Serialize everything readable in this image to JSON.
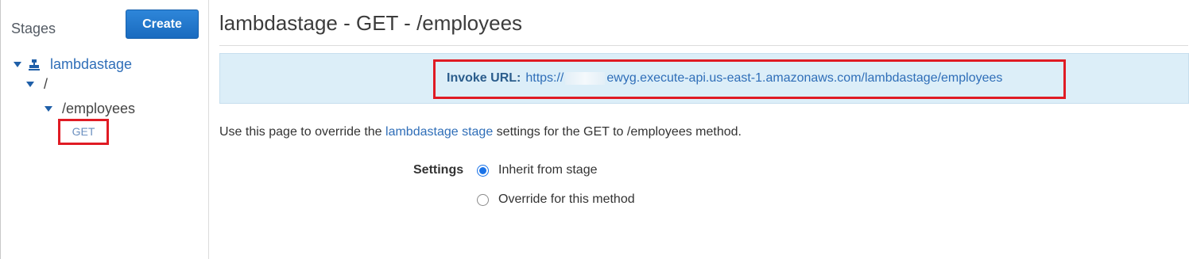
{
  "sidebar": {
    "heading": "Stages",
    "create_label": "Create",
    "tree": {
      "stage": "lambdastage",
      "root": "/",
      "resource": "/employees",
      "method": "GET"
    }
  },
  "main": {
    "title": "lambdastage - GET - /employees",
    "invoke": {
      "label": "Invoke URL:",
      "url_prefix": "https://",
      "url_suffix": "ewyg.execute-api.us-east-1.amazonaws.com/lambdastage/employees"
    },
    "description": {
      "prefix": "Use this page to override the ",
      "link": "lambdastage stage",
      "suffix": " settings for the GET to /employees method."
    },
    "settings": {
      "label": "Settings",
      "options": [
        {
          "label": "Inherit from stage",
          "selected": true
        },
        {
          "label": "Override for this method",
          "selected": false
        }
      ]
    }
  },
  "colors": {
    "accent": "#2f6eb8",
    "create_button": "#1a6bbf",
    "highlight": "#e01b24",
    "invoke_box": "#dceef8"
  },
  "icons": {
    "caret": "caret-down-icon",
    "stage": "stage-icon"
  }
}
